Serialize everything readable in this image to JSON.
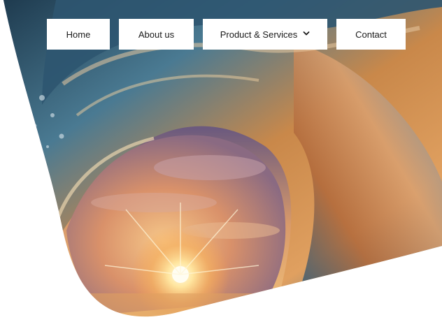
{
  "nav": {
    "items": [
      {
        "label": "Home"
      },
      {
        "label": "About us"
      },
      {
        "label": "Product & Services",
        "has_dropdown": true
      },
      {
        "label": "Contact"
      }
    ]
  },
  "hero": {
    "image": "ocean-wave-sunset"
  },
  "colors": {
    "nav_bg": "#ffffff",
    "nav_text": "#1a1a1a",
    "page_bg": "#ffffff"
  }
}
